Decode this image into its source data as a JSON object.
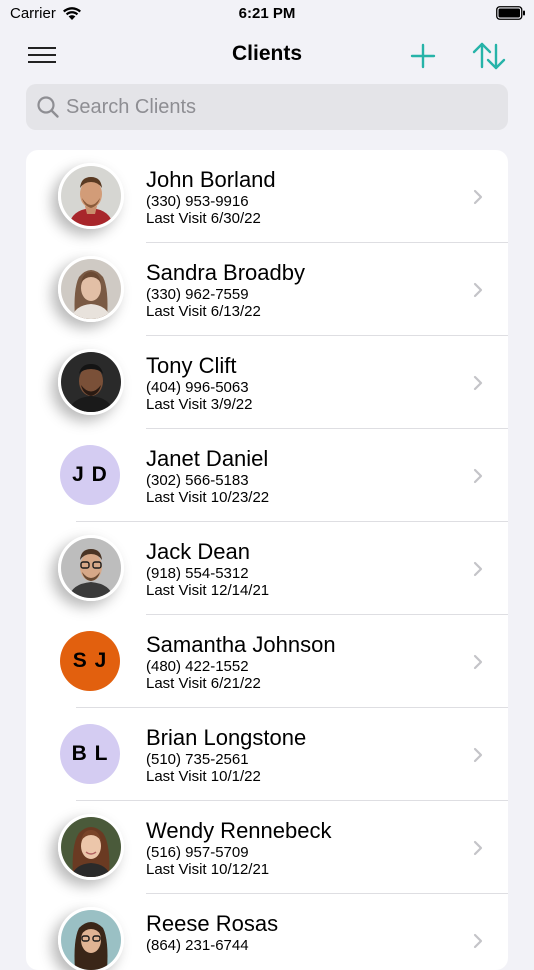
{
  "status_bar": {
    "carrier": "Carrier",
    "time": "6:21 PM"
  },
  "nav": {
    "title": "Clients",
    "menu_icon": "hamburger-menu-icon",
    "add_icon": "plus-icon",
    "sort_icon": "sort-arrows-icon",
    "accent_color": "#26b3a8"
  },
  "search": {
    "placeholder": "Search Clients",
    "value": ""
  },
  "clients": [
    {
      "name": "John Borland",
      "phone": "(330) 953-9916",
      "last_visit": "Last Visit 6/30/22",
      "avatar": "photo"
    },
    {
      "name": "Sandra Broadby",
      "phone": "(330) 962-7559",
      "last_visit": "Last Visit 6/13/22",
      "avatar": "photo"
    },
    {
      "name": "Tony Clift",
      "phone": "(404) 996-5063",
      "last_visit": "Last Visit 3/9/22",
      "avatar": "photo"
    },
    {
      "name": "Janet Daniel",
      "phone": "(302) 566-5183",
      "last_visit": "Last Visit 10/23/22",
      "avatar": "initials",
      "initials": "J D",
      "avatar_color": "#d4ccf2"
    },
    {
      "name": "Jack Dean",
      "phone": "(918) 554-5312",
      "last_visit": "Last Visit 12/14/21",
      "avatar": "photo"
    },
    {
      "name": "Samantha Johnson",
      "phone": "(480) 422-1552",
      "last_visit": "Last Visit 6/21/22",
      "avatar": "initials",
      "initials": "S J",
      "avatar_color": "#e2600e"
    },
    {
      "name": "Brian Longstone",
      "phone": "(510) 735-2561",
      "last_visit": "Last Visit 10/1/22",
      "avatar": "initials",
      "initials": "B L",
      "avatar_color": "#d4ccf2"
    },
    {
      "name": "Wendy Rennebeck",
      "phone": "(516) 957-5709",
      "last_visit": "Last Visit 10/12/21",
      "avatar": "photo"
    },
    {
      "name": "Reese Rosas",
      "phone": "(864) 231-6744",
      "last_visit": "",
      "avatar": "photo"
    }
  ]
}
